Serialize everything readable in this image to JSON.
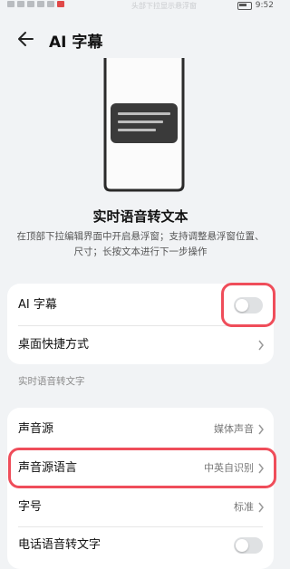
{
  "status_bar": {
    "center_text": "头部下拉显示悬浮窗",
    "time": "9:52"
  },
  "header": {
    "title": "AI 字幕",
    "back_icon": "arrow-left-icon"
  },
  "intro": {
    "title": "实时语音转文本",
    "description": "在顶部下拉编辑界面中开启悬浮窗；支持调整悬浮窗位置、尺寸；长按文本进行下一步操作"
  },
  "group1": {
    "ai_caption": {
      "label": "AI 字幕",
      "toggle_on": false
    },
    "desktop_shortcut": {
      "label": "桌面快捷方式"
    }
  },
  "section": {
    "label": "实时语音转文字"
  },
  "group2": {
    "sound_source": {
      "label": "声音源",
      "value": "媒体声音"
    },
    "source_language": {
      "label": "声音源语言",
      "value": "中英自识别"
    },
    "font_size": {
      "label": "字号",
      "value": "标准"
    },
    "phone_transcribe": {
      "label": "电话语音转文字",
      "toggle_on": false
    }
  },
  "colors": {
    "accent_highlight": "#ef4d5a",
    "background": "#f1f3f5",
    "card": "#ffffff"
  }
}
